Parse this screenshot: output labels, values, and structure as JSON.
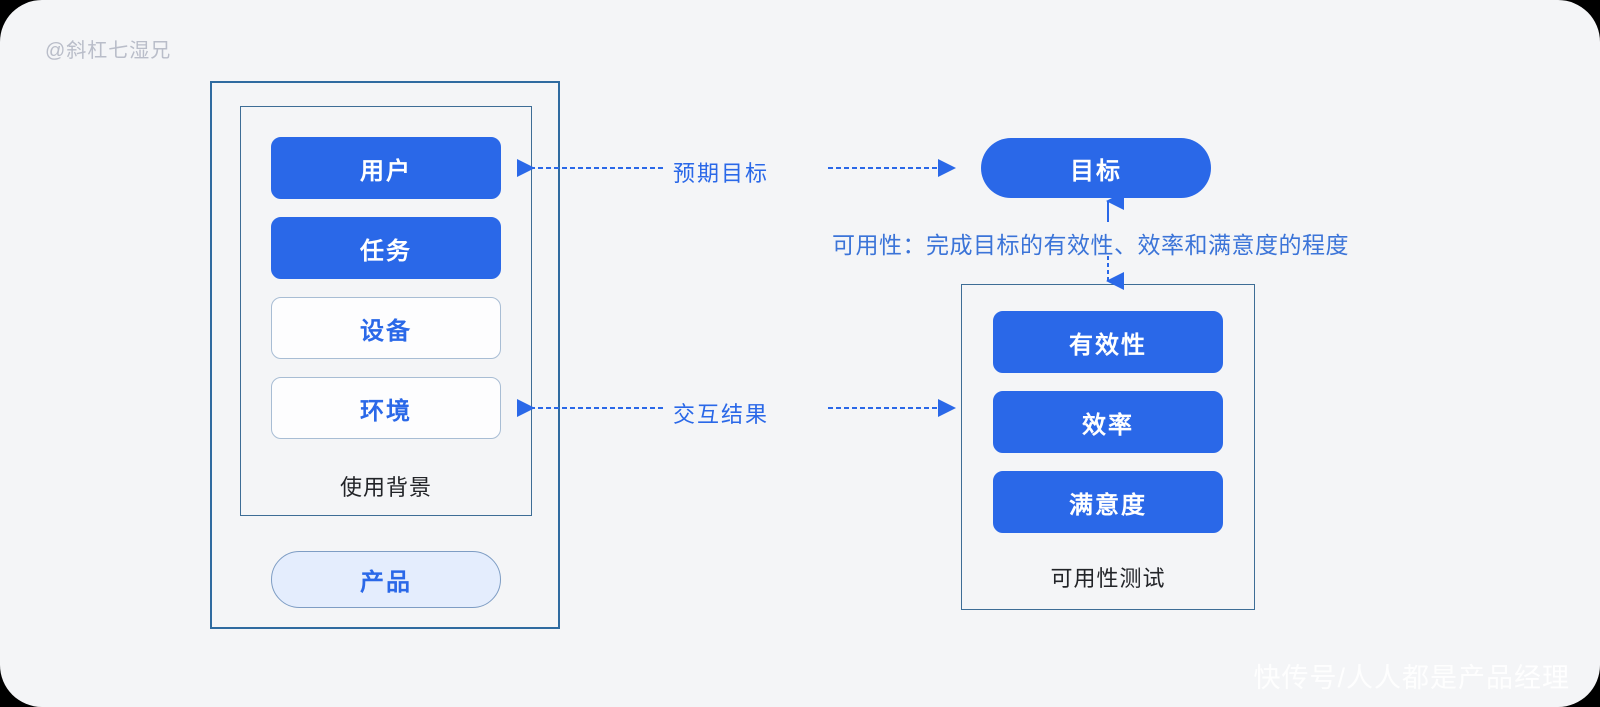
{
  "page": {
    "background": "#f4f5f7",
    "accent": "#2a68e8",
    "border_blue": "#3d6d96"
  },
  "watermarks": {
    "top_left": "@斜杠七湿兄",
    "bottom_right": "快传号/人人都是产品经理"
  },
  "context_panel": {
    "label": "使用背景",
    "chips": [
      {
        "text": "用户",
        "style": "solid"
      },
      {
        "text": "任务",
        "style": "solid"
      },
      {
        "text": "设备",
        "style": "ghost"
      },
      {
        "text": "环境",
        "style": "ghost"
      }
    ],
    "product": "产品"
  },
  "goal_panel": {
    "goal": "目标",
    "usability_definition": "可用性：完成目标的有效性、效率和满意度的程度",
    "test_label": "可用性测试",
    "test_items": [
      {
        "text": "有效性"
      },
      {
        "text": "效率"
      },
      {
        "text": "满意度"
      }
    ]
  },
  "connectors": {
    "expected_goal": "预期目标",
    "interaction_result": "交互结果"
  }
}
